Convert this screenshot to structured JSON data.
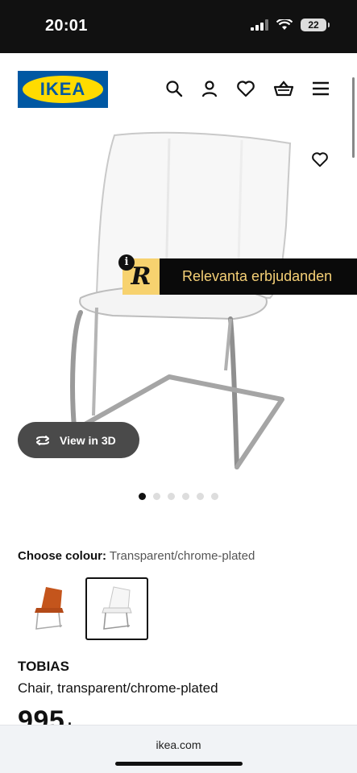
{
  "status_bar": {
    "time": "20:01",
    "battery": "22"
  },
  "header": {
    "logo_text": "IKEA",
    "icons": [
      "search-icon",
      "user-icon",
      "heart-icon",
      "basket-icon",
      "menu-icon"
    ]
  },
  "product_image": {
    "description_icon": "chair-image"
  },
  "promo": {
    "badge_letter": "R",
    "info": "i",
    "text": "Relevanta erbjudanden"
  },
  "view3d": {
    "label": "View in 3D"
  },
  "carousel": {
    "count": 6,
    "active": 0
  },
  "colour": {
    "label": "Choose colour:",
    "value": "Transparent/chrome-plated"
  },
  "swatches": [
    {
      "name": "orange",
      "selected": false
    },
    {
      "name": "transparent",
      "selected": true
    }
  ],
  "product": {
    "name": "TOBIAS",
    "description": "Chair, transparent/chrome-plated",
    "price": "995",
    "price_suffix": "."
  },
  "browser": {
    "url": "ikea.com"
  },
  "colors": {
    "ikea_blue": "#0058a3",
    "ikea_yellow": "#ffdb00",
    "promo_gold": "#f4cf76"
  }
}
